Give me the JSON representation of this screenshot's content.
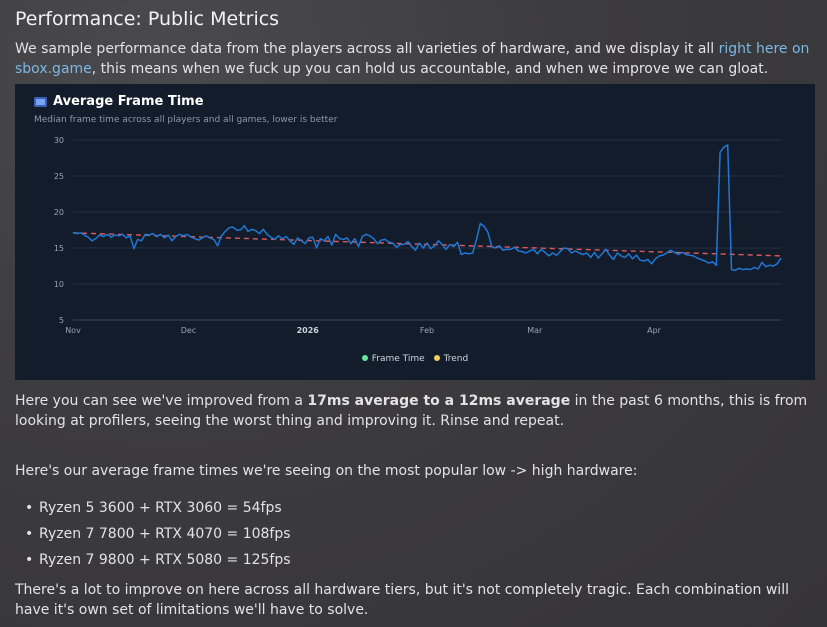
{
  "heading": "Performance: Public Metrics",
  "intro": {
    "text_before": "We sample performance data from the players across all varieties of hardware, and we display it all ",
    "link": "right here on sbox.game",
    "text_after": ", this means when we fuck up you can hold us accountable, and when we improve we can gloat."
  },
  "chart": {
    "title": "Average Frame Time",
    "subtitle": "Median frame time across all players and all games, lower is better",
    "icon": "film-icon"
  },
  "chart_data": {
    "type": "line",
    "title": "Average Frame Time",
    "subtitle": "Median frame time across all players and all games, lower is better",
    "xlabel": "",
    "ylabel": "",
    "ylim": [
      5,
      30
    ],
    "xlim": [
      0,
      184
    ],
    "yticks": [
      5,
      10,
      15,
      20,
      25,
      30
    ],
    "xticks": [
      {
        "label": "Nov",
        "x": 0
      },
      {
        "label": "Dec",
        "x": 30
      },
      {
        "label": "2026",
        "x": 61,
        "bold": true
      },
      {
        "label": "Feb",
        "x": 92
      },
      {
        "label": "Mar",
        "x": 120
      },
      {
        "label": "Apr",
        "x": 151
      }
    ],
    "grid": true,
    "legend_position": "bottom",
    "series": [
      {
        "name": "Frame Time",
        "color": "#1f77d4",
        "legend_color": "#69e39a",
        "values": [
          17.2,
          17.0,
          17.1,
          16.8,
          16.5,
          16.0,
          16.3,
          16.8,
          16.6,
          16.9,
          16.5,
          16.8,
          16.7,
          16.9,
          16.4,
          16.7,
          14.9,
          16.2,
          16.0,
          16.9,
          16.8,
          17.0,
          16.6,
          16.9,
          16.4,
          16.8,
          16.0,
          16.6,
          16.9,
          16.7,
          16.9,
          16.5,
          16.3,
          16.1,
          16.4,
          16.7,
          16.4,
          16.2,
          15.3,
          16.7,
          17.3,
          17.8,
          17.9,
          17.5,
          17.5,
          18.1,
          17.3,
          17.6,
          17.4,
          17.0,
          17.6,
          16.9,
          16.5,
          16.2,
          16.7,
          16.3,
          16.6,
          16.0,
          15.5,
          16.4,
          16.0,
          15.6,
          16.4,
          16.5,
          15.0,
          16.3,
          16.0,
          16.6,
          15.4,
          16.9,
          16.3,
          16.2,
          16.4,
          15.6,
          16.3,
          15.2,
          16.6,
          16.9,
          16.7,
          16.3,
          15.6,
          16.1,
          16.2,
          15.8,
          15.7,
          15.1,
          15.5,
          15.5,
          15.9,
          15.2,
          14.7,
          15.7,
          15.0,
          15.7,
          14.9,
          15.3,
          16.0,
          15.5,
          14.8,
          15.5,
          15.2,
          15.8,
          14.1,
          14.3,
          14.2,
          14.3,
          16.2,
          18.4,
          18.0,
          17.2,
          15.2,
          15.0,
          15.3,
          14.7,
          14.8,
          14.8,
          15.1,
          14.6,
          14.5,
          14.3,
          14.6,
          14.8,
          14.2,
          14.8,
          14.4,
          13.9,
          14.3,
          14.0,
          14.5,
          15.0,
          14.9,
          14.3,
          14.6,
          14.3,
          14.1,
          14.3,
          13.7,
          14.4,
          13.6,
          14.2,
          14.8,
          14.0,
          13.4,
          14.3,
          13.9,
          13.7,
          14.2,
          13.5,
          14.0,
          13.3,
          13.2,
          13.4,
          12.8,
          13.5,
          13.9,
          14.0,
          14.3,
          14.7,
          14.4,
          14.1,
          14.4,
          14.1,
          14.0,
          13.9,
          13.6,
          13.4,
          13.2,
          12.9,
          13.1,
          12.6,
          28.3,
          29.0,
          29.3,
          12.0,
          11.9,
          12.2,
          12.0,
          12.1,
          12.0,
          12.3,
          12.1,
          13.0,
          12.4,
          12.6,
          12.5,
          12.8,
          13.6
        ]
      },
      {
        "name": "Trend",
        "color": "#e05a5a",
        "legend_color": "#f2d15b",
        "dashed": true,
        "values": [
          17.1,
          13.9
        ]
      }
    ]
  },
  "paragraph1": {
    "before": "Here you can see we've improved from a ",
    "bold": "17ms average to a 12ms average",
    "after": " in the past 6 months, this is from looking at profilers, seeing the worst thing and improving it. Rinse and repeat."
  },
  "paragraph2": "Here's our average frame times we're seeing on the most popular low -> high hardware:",
  "hardware": [
    "Ryzen 5 3600 + RTX 3060 = 54fps",
    "Ryzen 7 7800 + RTX 4070 = 108fps",
    "Ryzen 7 9800 + RTX 5080 = 125fps"
  ],
  "bullet_symbol": "•",
  "paragraph3": "There's a lot to improve on here across all hardware tiers, but it's not completely tragic. Each combination will have it's own set of limitations we'll have to solve."
}
